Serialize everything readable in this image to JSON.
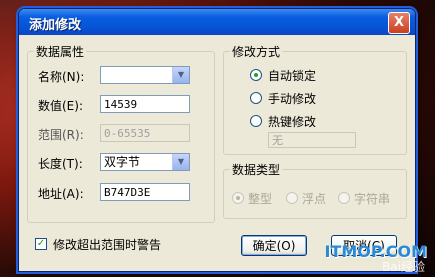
{
  "dialog": {
    "title": "添加修改",
    "close_label": "X"
  },
  "data_props": {
    "group_title": "数据属性",
    "name_label": "名称(N):",
    "name_value": "",
    "value_label": "数值(E):",
    "value_value": "14539",
    "range_label": "范围(R):",
    "range_value": "0-65535",
    "length_label": "长度(T):",
    "length_value": "双字节",
    "address_label": "地址(A):",
    "address_value": "B747D3E"
  },
  "modify_mode": {
    "group_title": "修改方式",
    "options": [
      "自动锁定",
      "手动修改",
      "热键修改"
    ],
    "selected": "自动锁定",
    "hotkey_value": "无"
  },
  "data_type": {
    "group_title": "数据类型",
    "options": [
      "整型",
      "浮点",
      "字符串"
    ],
    "selected": "整型"
  },
  "warn_checkbox": {
    "label": "修改超出范围时警告",
    "checked": true
  },
  "buttons": {
    "ok": "确定(O)",
    "cancel": "取消(C)"
  },
  "watermark": {
    "text": "ITMOP.COM",
    "sub": "Bai经验"
  }
}
